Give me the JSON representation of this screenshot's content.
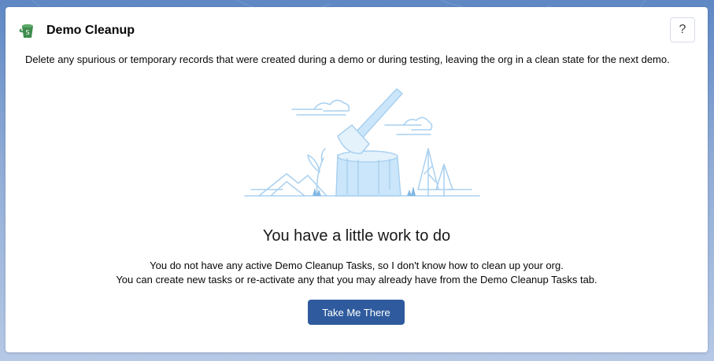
{
  "header": {
    "title": "Demo Cleanup",
    "app_icon": "bucket-icon",
    "help_label": "?"
  },
  "description": "Delete any spurious or temporary records that were created during a demo or during testing, leaving the org in a clean state for the next demo.",
  "empty_state": {
    "illustration": "axe-in-stump-illustration",
    "heading": "You have a little work to do",
    "line1": "You do not have any active Demo Cleanup Tasks, so I don't know how to clean up your org.",
    "line2": "You can create new tasks or re-activate any that you may already have from the Demo Cleanup Tasks tab.",
    "button_label": "Take Me There"
  },
  "colors": {
    "brand_icon": "#3f8c4d",
    "button": "#2f5b9e",
    "illustration_stroke": "#a8d0f0",
    "illustration_fill": "#cbe6fa"
  }
}
